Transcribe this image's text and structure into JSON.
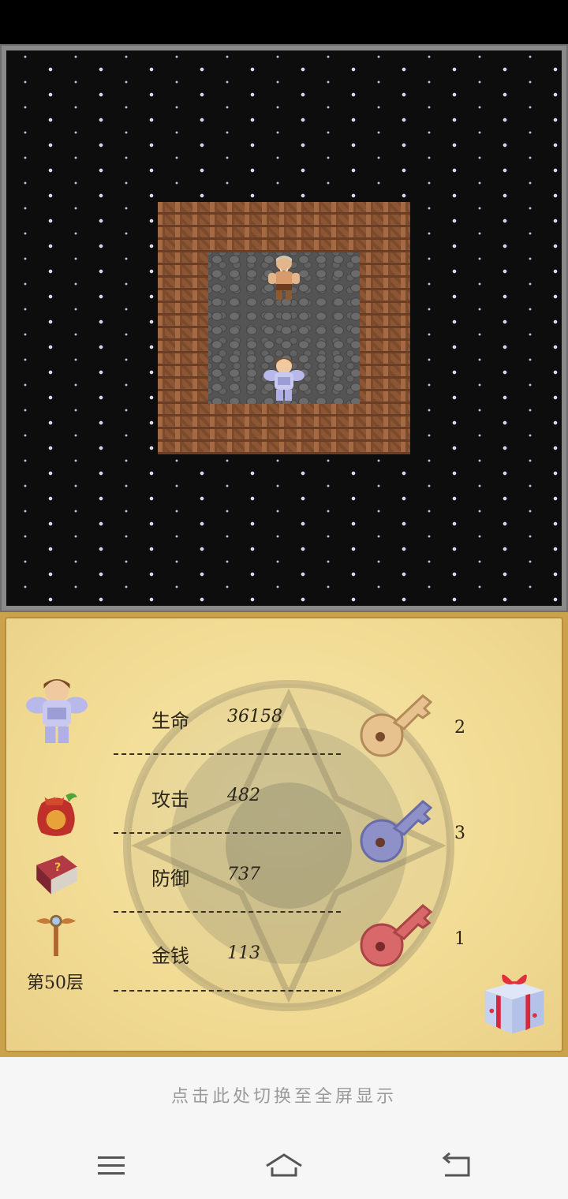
{
  "board": {
    "floor_tile": "cobblestone",
    "wall_tile": "brick",
    "background_tile": "starfield",
    "hero_sprite": "armored-hero",
    "npc_sprite": "old-bearded-merchant"
  },
  "hud": {
    "floor_label": "第50层",
    "stats": [
      {
        "label": "生命",
        "value": "36158"
      },
      {
        "label": "攻击",
        "value": "482"
      },
      {
        "label": "防御",
        "value": "737"
      },
      {
        "label": "金钱",
        "value": "113"
      }
    ],
    "keys": [
      {
        "color": "yellow",
        "hex": "#e8c28e",
        "count": "2"
      },
      {
        "color": "blue",
        "hex": "#8e90c8",
        "count": "3"
      },
      {
        "color": "red",
        "hex": "#d9686a",
        "count": "1"
      }
    ],
    "items": [
      "lucky-bag-icon",
      "monster-manual-icon",
      "fly-wand-icon"
    ],
    "gift_icon": "gift-box-icon"
  },
  "hint": "点击此处切换至全屏显示",
  "navbar": {
    "menu_icon": "menu-icon",
    "home_icon": "home-icon",
    "back_icon": "back-icon"
  }
}
